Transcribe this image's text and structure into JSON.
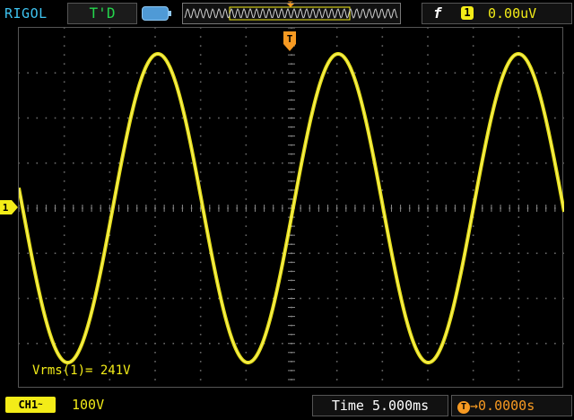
{
  "header": {
    "brand": "RIGOL",
    "run_status": "T'D",
    "trigger_source": "1",
    "trigger_level": "0.00uV",
    "trigger_position_label": "T"
  },
  "channel": {
    "name": "CH1",
    "coupling_symbol": "~",
    "scale": "100V",
    "marker": "1",
    "color": "#f3ec18"
  },
  "measurement": {
    "label": "Vrms(1)=",
    "value": "241V"
  },
  "timebase": {
    "label": "Time",
    "value": "5.000ms",
    "offset": "0.0000s",
    "offset_icon": "T"
  },
  "colors": {
    "trace": "#f3ec18",
    "brand": "#3ec3f0",
    "status": "#24d64c",
    "trigger": "#f79a22"
  }
}
